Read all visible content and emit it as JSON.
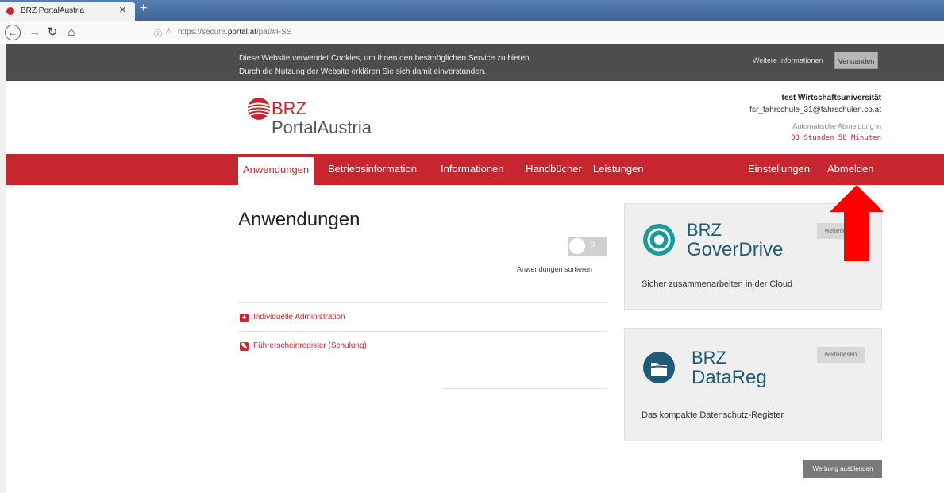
{
  "browser": {
    "tab_title": "BRZ PortalAustria",
    "tab_close": "×",
    "new_tab": "+",
    "url_prefix": "https://secure.",
    "url_domain": "portal.at",
    "url_path": "/pat/#FSS",
    "icons": [
      "back-icon",
      "forward-icon",
      "reload-icon",
      "home-icon",
      "info-icon",
      "lock-icon"
    ]
  },
  "cookie_banner": {
    "line1": "Diese Website verwendet Cookies, um Ihnen den bestmöglichen Service zu bieten.",
    "line2": "Durch die Nutzung der Website erklären Sie sich damit einverstanden.",
    "more_info": "Weitere Informationen",
    "accept": "Verstanden"
  },
  "header": {
    "logo_brz": "BRZ",
    "logo_portal": "PortalAustria",
    "user_name": "test Wirtschaftsuniversität",
    "user_email": "fsr_fahrschule_31@fahrschulen.co.at",
    "auto_logout_label": "Automatische Abmeldung in",
    "auto_logout_time": "03 Stunden 58 Minuten"
  },
  "nav": {
    "anwendungen": "Anwendungen",
    "betriebsinformation": "Betriebsinformation",
    "informationen": "Informationen",
    "handbuecher": "Handbücher",
    "leistungen": "Leistungen",
    "einstellungen": "Einstellungen",
    "abmelden": "Abmelden"
  },
  "main": {
    "title": "Anwendungen",
    "toggle_state": "0",
    "sort_label": "Anwendungen sortieren",
    "apps": [
      {
        "label": "Individuelle Administration",
        "icon": "plus-icon"
      },
      {
        "label": "Führerscheinregister (Schulung)",
        "icon": "edit-icon"
      }
    ]
  },
  "ads": {
    "goverdrive": {
      "brz": "BRZ",
      "name": "GoverDrive",
      "desc": "Sicher zusammenarbeiten in der Cloud",
      "more": "weiterlesen"
    },
    "datareg": {
      "brz": "BRZ",
      "name": "DataReg",
      "desc": "Das kompakte Datenschutz-Register",
      "more": "weiterlesen"
    },
    "hide": "Werbung ausblenden"
  },
  "colors": {
    "brand_red": "#c8262e",
    "ad_blue": "#1f5b78",
    "arrow": "#ff0000"
  }
}
